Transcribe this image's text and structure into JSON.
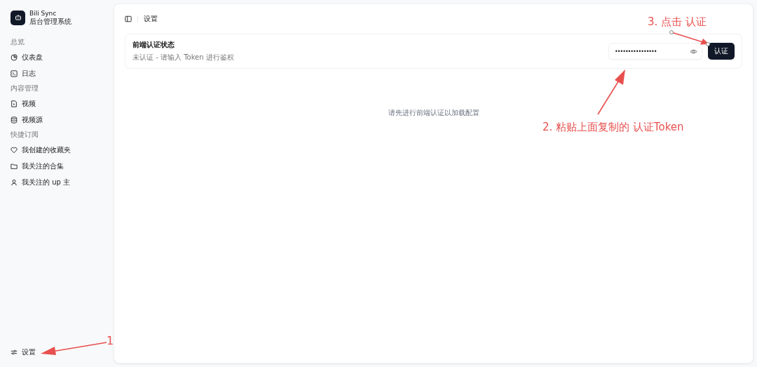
{
  "app": {
    "name": "Bili Sync",
    "subtitle": "后台管理系统"
  },
  "sidebar": {
    "groups": [
      {
        "label": "总览",
        "items": [
          {
            "label": "仪表盘"
          },
          {
            "label": "日志"
          }
        ]
      },
      {
        "label": "内容管理",
        "items": [
          {
            "label": "视频"
          },
          {
            "label": "视频源"
          }
        ]
      },
      {
        "label": "快捷订阅",
        "items": [
          {
            "label": "我创建的收藏夹"
          },
          {
            "label": "我关注的合集"
          },
          {
            "label": "我关注的 up 主"
          }
        ]
      }
    ],
    "footer": {
      "label": "设置"
    }
  },
  "header": {
    "breadcrumb": "设置"
  },
  "auth_card": {
    "title": "前端认证状态",
    "status": "未认证 - 请输入 Token 进行鉴权",
    "token_field": {
      "value": "••••••••••••••••"
    },
    "button": "认证"
  },
  "empty_message": "请先进行前端认证以加载配置",
  "annotations": [
    {
      "kind": "step3",
      "text": "3. 点击 认证"
    },
    {
      "kind": "step2",
      "text": "2. 粘贴上面复制的 认证Token"
    },
    {
      "kind": "step1",
      "text": "1"
    }
  ]
}
